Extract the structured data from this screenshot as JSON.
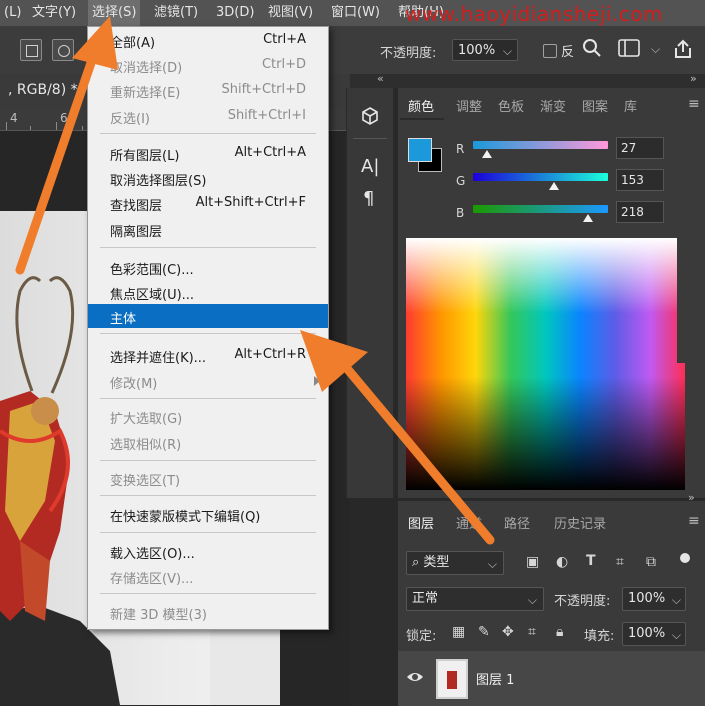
{
  "menubar": {
    "items": [
      {
        "label": "(L)"
      },
      {
        "label": "文字(Y)"
      },
      {
        "label": "选择(S)"
      },
      {
        "label": "滤镜(T)"
      },
      {
        "label": "3D(D)"
      },
      {
        "label": "视图(V)"
      },
      {
        "label": "窗口(W)"
      },
      {
        "label": "帮助(H)"
      }
    ],
    "watermark": "www.haoyidiansheji.com"
  },
  "options_bar": {
    "opacity_label": "不透明度:",
    "opacity_value": "100%",
    "invert_label": "反"
  },
  "document": {
    "tab_text": ", RGB/8) *",
    "ruler_numbers": [
      "4",
      "6"
    ]
  },
  "select_menu": {
    "items": [
      {
        "label": "全部(A)",
        "shortcut": "Ctrl+A",
        "disabled": false
      },
      {
        "label": "取消选择(D)",
        "shortcut": "Ctrl+D",
        "disabled": true
      },
      {
        "label": "重新选择(E)",
        "shortcut": "Shift+Ctrl+D",
        "disabled": true
      },
      {
        "label": "反选(I)",
        "shortcut": "Shift+Ctrl+I",
        "disabled": true
      },
      {
        "label": "所有图层(L)",
        "shortcut": "Alt+Ctrl+A",
        "disabled": false
      },
      {
        "label": "取消选择图层(S)",
        "shortcut": "",
        "disabled": false
      },
      {
        "label": "查找图层",
        "shortcut": "Alt+Shift+Ctrl+F",
        "disabled": false
      },
      {
        "label": "隔离图层",
        "shortcut": "",
        "disabled": false
      },
      {
        "label": "色彩范围(C)...",
        "shortcut": "",
        "disabled": false
      },
      {
        "label": "焦点区域(U)...",
        "shortcut": "",
        "disabled": false
      },
      {
        "label": "主体",
        "shortcut": "",
        "disabled": false,
        "highlighted": true
      },
      {
        "label": "选择并遮住(K)...",
        "shortcut": "Alt+Ctrl+R",
        "disabled": false
      },
      {
        "label": "修改(M)",
        "shortcut": "",
        "disabled": true,
        "submenu": true
      },
      {
        "label": "扩大选取(G)",
        "shortcut": "",
        "disabled": true
      },
      {
        "label": "选取相似(R)",
        "shortcut": "",
        "disabled": true
      },
      {
        "label": "变换选区(T)",
        "shortcut": "",
        "disabled": true
      },
      {
        "label": "在快速蒙版模式下编辑(Q)",
        "shortcut": "",
        "disabled": false
      },
      {
        "label": "载入选区(O)...",
        "shortcut": "",
        "disabled": false
      },
      {
        "label": "存储选区(V)...",
        "shortcut": "",
        "disabled": true
      },
      {
        "label": "新建 3D 模型(3)",
        "shortcut": "",
        "disabled": true
      }
    ]
  },
  "color_panel": {
    "tabs": [
      "颜色",
      "调整",
      "色板",
      "渐变",
      "图案",
      "库"
    ],
    "foreground_color": "#1b99da",
    "background_color": "#000000",
    "channels": [
      {
        "label": "R",
        "value": "27",
        "fraction": 0.106
      },
      {
        "label": "G",
        "value": "153",
        "fraction": 0.6
      },
      {
        "label": "B",
        "value": "218",
        "fraction": 0.855
      }
    ]
  },
  "layers_panel": {
    "tabs": [
      "图层",
      "通道",
      "路径",
      "历史记录"
    ],
    "filter_kind": "类型",
    "blend_mode": "正常",
    "opacity_label": "不透明度:",
    "opacity_value": "100%",
    "lock_label": "锁定:",
    "fill_label": "填充:",
    "fill_value": "100%",
    "layer_name": "图层 1"
  },
  "colors": {
    "accent_highlight": "#0a6fc2",
    "arrow_orange": "#f07d2b",
    "watermark_red": "#d41e1e"
  }
}
